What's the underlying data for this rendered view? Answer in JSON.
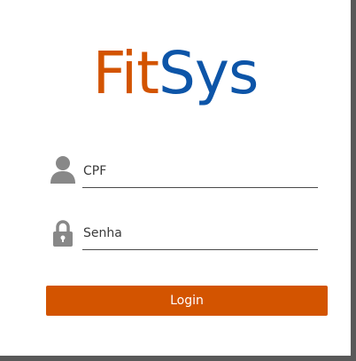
{
  "logo": {
    "part1": "Fit",
    "part2": "Sys"
  },
  "form": {
    "cpf": {
      "placeholder": "CPF",
      "value": "",
      "icon": "user-icon"
    },
    "senha": {
      "placeholder": "Senha",
      "value": "",
      "icon": "lock-icon"
    },
    "login_label": "Login"
  },
  "colors": {
    "accent": "#d35400",
    "brand_blue": "#0d55a8",
    "icon_gray": "#888888",
    "background": "#595959"
  }
}
